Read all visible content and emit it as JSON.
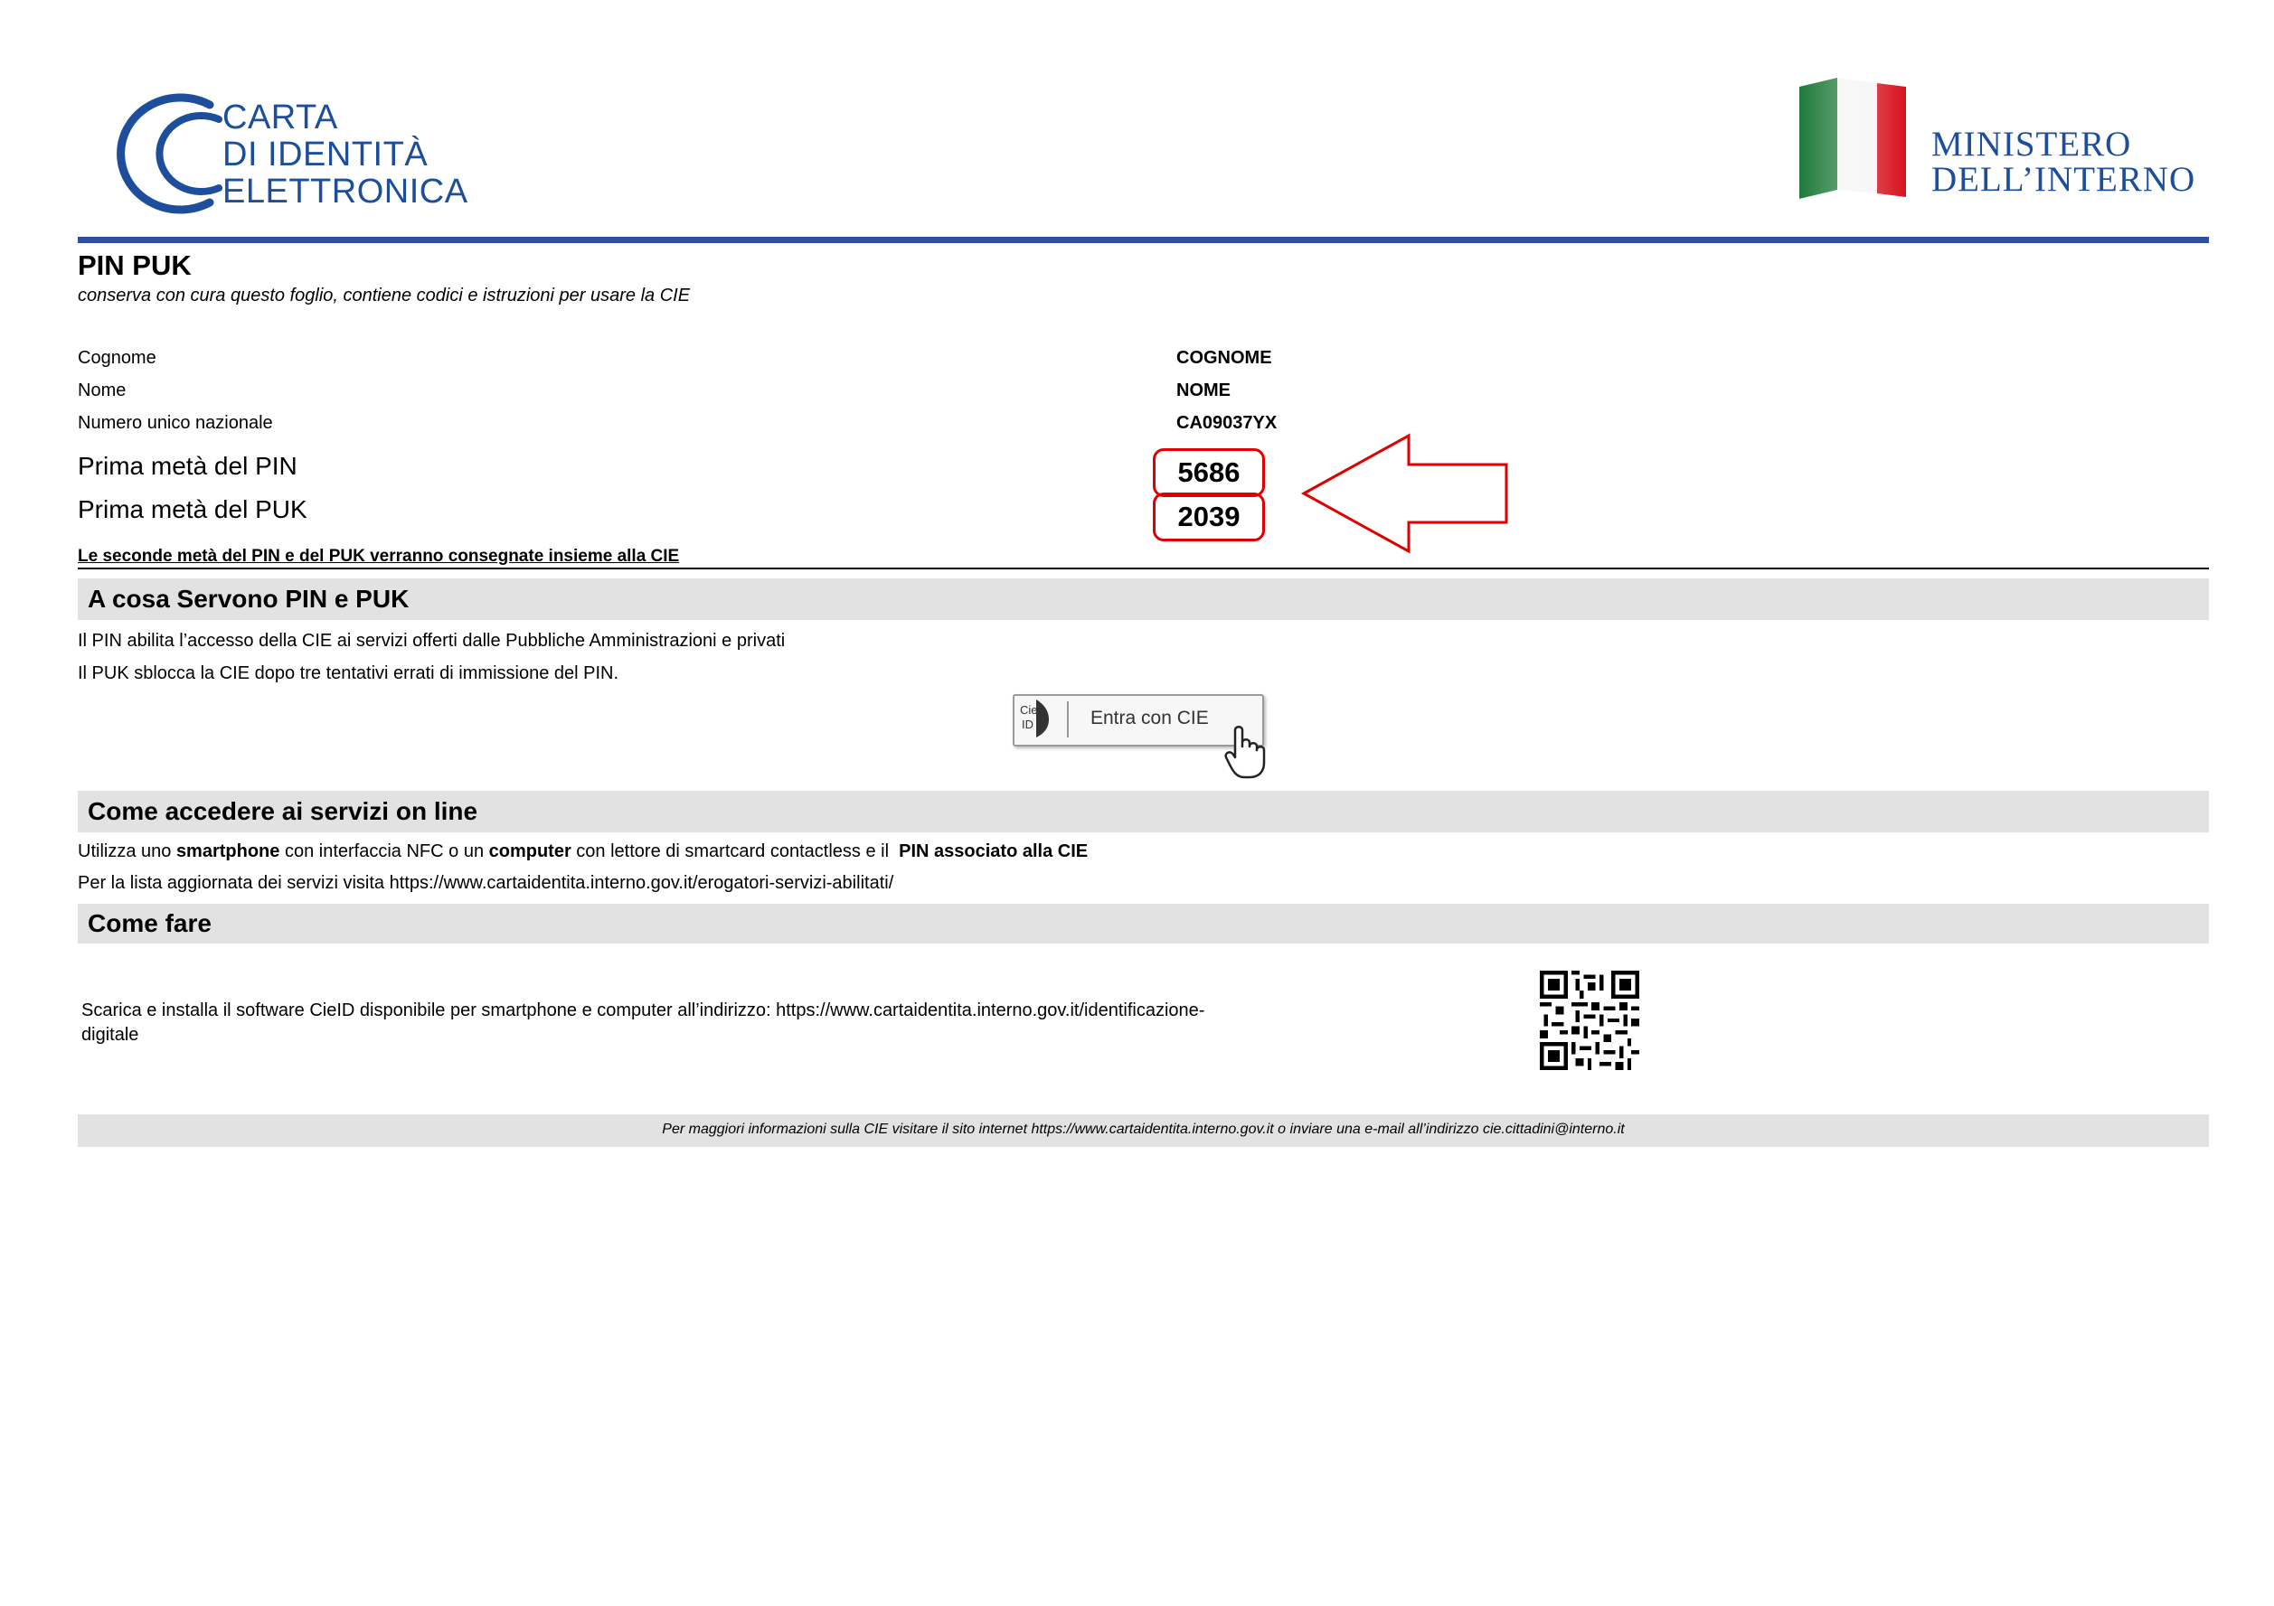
{
  "header": {
    "cie_logo_lines": [
      "CARTA",
      "DI IDENTITÀ",
      "ELETTRONICA"
    ],
    "ministry_lines": [
      "MINISTERO",
      "DELL’INTERNO"
    ],
    "colors": {
      "brand_blue": "#1d4e9b",
      "rule_blue": "#2f4f9f",
      "flag_green": "#1f7a3a",
      "flag_red": "#d6111e"
    }
  },
  "document": {
    "title": "PIN PUK",
    "subtitle": "conserva con cura questo foglio, contiene codici e istruzioni per usare la CIE"
  },
  "fields": [
    {
      "label": "Cognome",
      "value": "COGNOME"
    },
    {
      "label": "Nome",
      "value": "NOME"
    },
    {
      "label": "Numero unico nazionale",
      "value": "CA09037YX"
    }
  ],
  "codes": [
    {
      "label": "Prima metà del PIN",
      "value": "5686"
    },
    {
      "label": "Prima metà del PUK",
      "value": "2039"
    }
  ],
  "codes_note": "Le seconde metà del PIN e del PUK verranno consegnate insieme alla CIE",
  "sections": {
    "purpose": {
      "title": "A cosa Servono PIN e PUK",
      "lines": [
        "Il PIN abilita l’accesso della CIE ai servizi offerti dalle Pubbliche Amministrazioni e privati",
        "Il PUK sblocca la CIE dopo tre tentativi errati di immissione del PIN."
      ],
      "button": {
        "mark": [
          "Cie",
          "ID"
        ],
        "label": "Entra con CIE"
      }
    },
    "access": {
      "title": "Come accedere ai servizi on line",
      "line1": {
        "t1": "Utilizza uno ",
        "b1": "smartphone",
        "t2": " con interfaccia NFC o un ",
        "b2": "computer",
        "t3": " con lettore di smartcard contactless e il  ",
        "b3": "PIN associato alla CIE"
      },
      "line2": "Per la lista aggiornata dei servizi visita https://www.cartaidentita.interno.gov.it/erogatori-servizi-abilitati/"
    },
    "howto": {
      "title": "Come fare",
      "lines": [
        "Scarica e installa il software CieID disponibile per smartphone e computer all’indirizzo: https://www.cartaidentita.interno.gov.it/identificazione-",
        "digitale"
      ]
    }
  },
  "footer": "Per maggiori informazioni sulla CIE visitare il sito internet https://www.cartaidentita.interno.gov.it o inviare una e-mail all’indirizzo cie.cittadini@interno.it"
}
